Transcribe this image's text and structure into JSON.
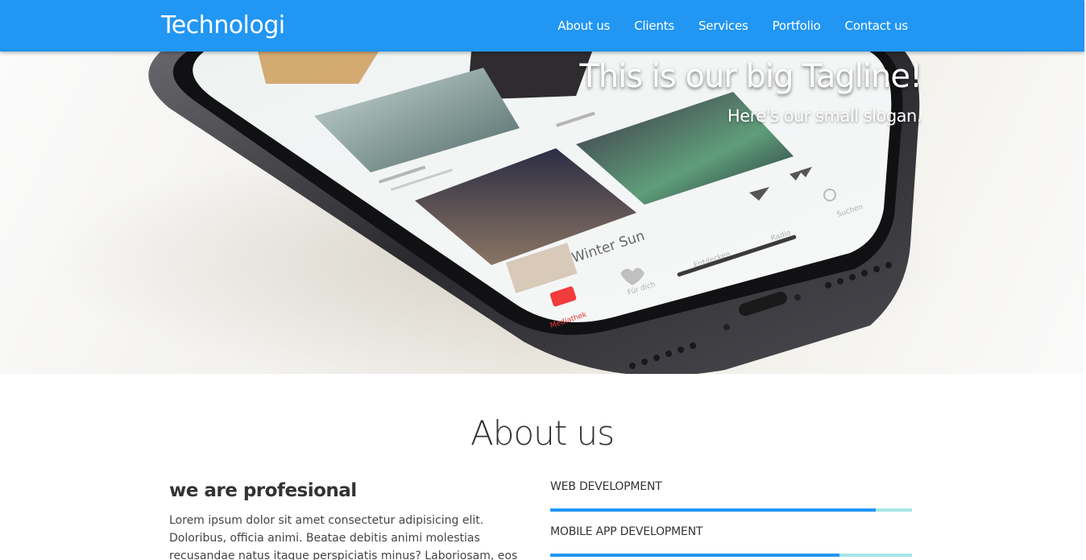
{
  "navbar": {
    "brand": "Technologi",
    "links": [
      {
        "label": "About us"
      },
      {
        "label": "Clients"
      },
      {
        "label": "Services"
      },
      {
        "label": "Portfolio"
      },
      {
        "label": "Contact us"
      }
    ],
    "color": "#2196f3"
  },
  "hero": {
    "tagline": "This is our big Tagline!",
    "slogan": "Here's our small slogan.",
    "screen_labels": {
      "song": "Winter Sun",
      "tabs": [
        "Mediathek",
        "Für dich",
        "Entdecken",
        "Radio",
        "Suchen"
      ]
    }
  },
  "about": {
    "title": "About us",
    "subtitle": "we are profesional",
    "text": "Lorem ipsum dolor sit amet consectetur adipisicing elit. Doloribus, officia animi. Beatae debitis animi molestias recusandae natus itaque perspiciatis minus? Laboriosam, eos pariatur, eius cum",
    "skills": [
      {
        "label": "WEB DEVELOPMENT",
        "level": 0.9
      },
      {
        "label": "MOBILE APP DEVELOPMENT",
        "level": 0.8
      }
    ],
    "bar_color": "#2196f3",
    "track_color": "#a6e6e6"
  }
}
